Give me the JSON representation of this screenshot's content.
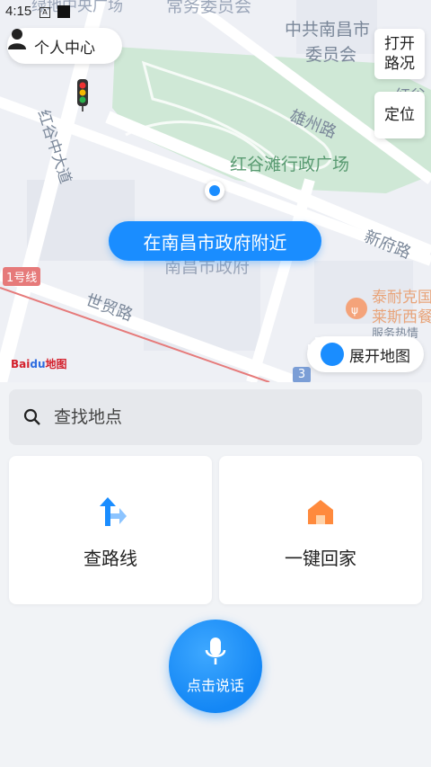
{
  "status": {
    "time": "4:15",
    "a_icon": "A"
  },
  "map": {
    "user_center_label": "个人中心",
    "traffic_label_line1": "打开",
    "traffic_label_line2": "路况",
    "locate_label": "定位",
    "location_text": "在南昌市政府附近",
    "expand_label": "展开地图",
    "labels": {
      "top_partial": "绿地中央广场",
      "standing_committee": "常务委员会",
      "party_line1": "中共南昌市",
      "party_line2": "委员会",
      "xiongzhou_road": "雄州路",
      "plaza": "红谷滩行政广场",
      "hong_gu": "红谷中大道",
      "xinfu_road": "新府路",
      "shimao_road": "世贸路",
      "gov": "南昌市政府",
      "taiku_line1": "泰耐克国",
      "taiku_line2": "莱斯西餐",
      "service_hot": "服务热情",
      "hong_partial": "红谷",
      "metro_line": "1号线",
      "road_no": "3"
    },
    "baidu_logo_b": "Bai",
    "baidu_logo_du": "du",
    "baidu_logo_map": "地图"
  },
  "panel": {
    "search_placeholder": "查找地点",
    "route_label": "查路线",
    "home_label": "一键回家",
    "voice_label": "点击说话"
  },
  "colors": {
    "accent": "#1a8dff",
    "park": "#cfe8d6",
    "metro": "#e67a7a",
    "home_icon": "#ff8a3d"
  },
  "icons": {
    "user": "user-icon",
    "traffic_light": "traffic-light-icon",
    "expand": "expand-icon",
    "search": "search-icon",
    "route": "route-arrow-icon",
    "home": "home-icon",
    "mic": "mic-icon",
    "restaurant": "fork-knife-icon"
  }
}
